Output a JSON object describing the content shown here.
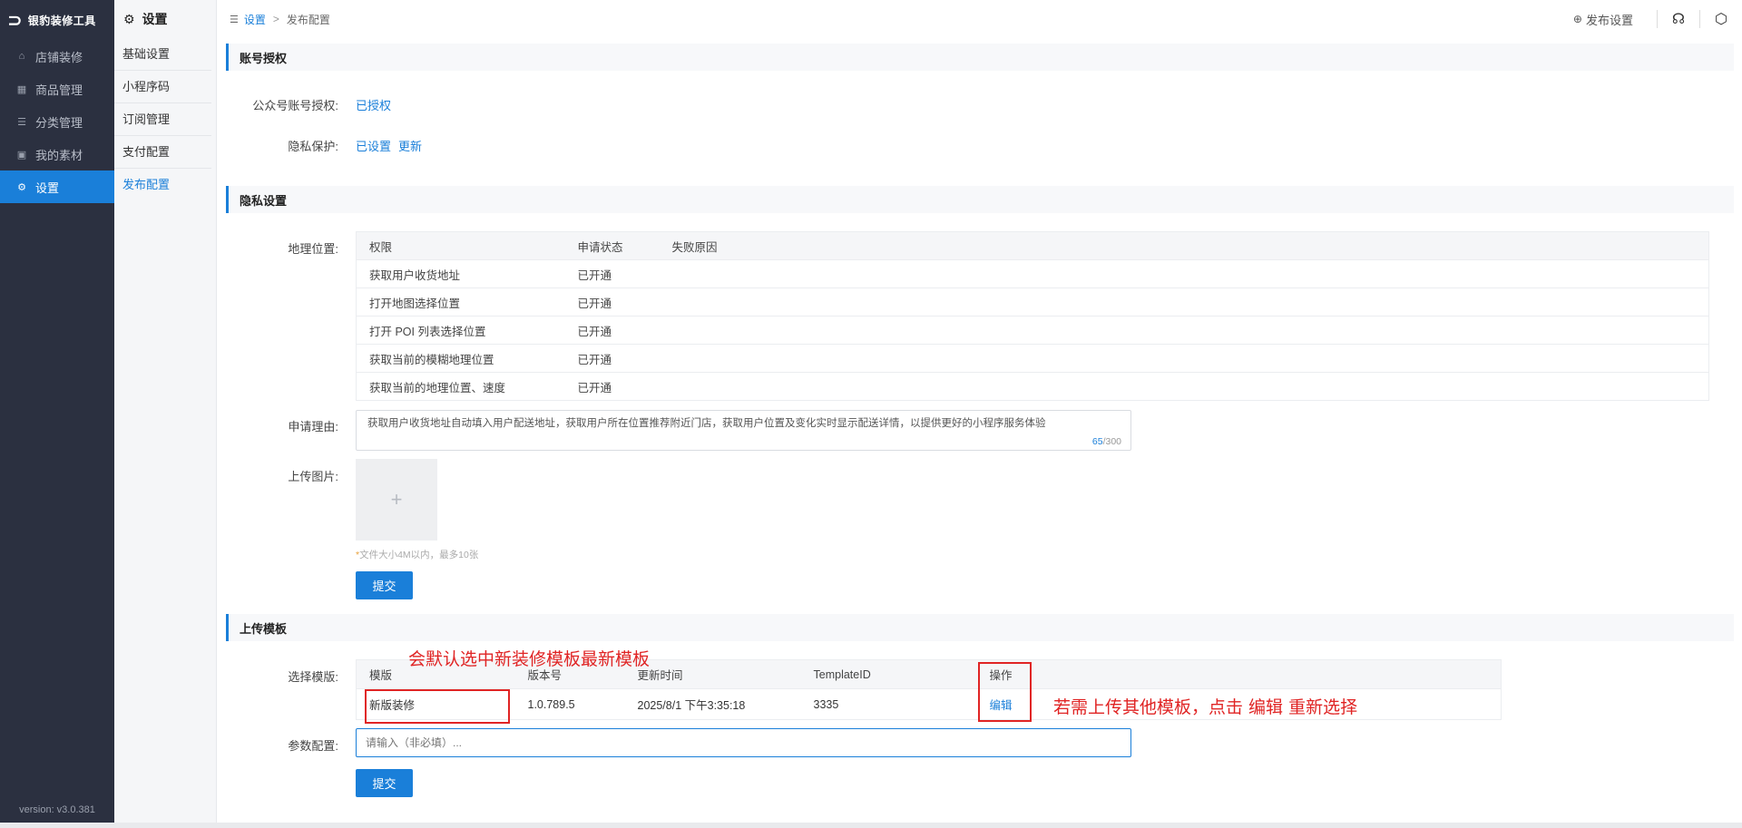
{
  "nav": {
    "brand": "银豹装修工具",
    "items": [
      {
        "label": "店铺装修",
        "icon": "store-icon"
      },
      {
        "label": "商品管理",
        "icon": "grid-icon"
      },
      {
        "label": "分类管理",
        "icon": "list-icon"
      },
      {
        "label": "我的素材",
        "icon": "image-icon"
      },
      {
        "label": "设置",
        "icon": "gear-icon",
        "active": true
      }
    ],
    "version": "version: v3.0.381"
  },
  "submenu": {
    "title": "设置",
    "items": [
      "基础设置",
      "小程序码",
      "订阅管理",
      "支付配置",
      "发布配置"
    ],
    "active_index": 4
  },
  "header": {
    "breadcrumb": [
      "设置",
      "发布配置"
    ],
    "publish_settings": "发布设置"
  },
  "account": {
    "section_title": "账号授权",
    "mp_label": "公众号账号授权:",
    "mp_value": "已授权",
    "privacy_label": "隐私保护:",
    "privacy_value": "已设置",
    "privacy_update": "更新"
  },
  "privacy": {
    "section_title": "隐私设置",
    "location_label": "地理位置:",
    "columns": [
      "权限",
      "申请状态",
      "失败原因"
    ],
    "rows": [
      [
        "获取用户收货地址",
        "已开通",
        ""
      ],
      [
        "打开地图选择位置",
        "已开通",
        ""
      ],
      [
        "打开 POI 列表选择位置",
        "已开通",
        ""
      ],
      [
        "获取当前的模糊地理位置",
        "已开通",
        ""
      ],
      [
        "获取当前的地理位置、速度",
        "已开通",
        ""
      ]
    ],
    "reason_label": "申请理由:",
    "reason_text": "获取用户收货地址自动填入用户配送地址，获取用户所在位置推荐附近门店，获取用户位置及变化实时显示配送详情，以提供更好的小程序服务体验",
    "reason_count": "65",
    "reason_max": "/300",
    "upload_label": "上传图片:",
    "upload_tip": "文件大小4M以内，最多10张",
    "submit": "提交"
  },
  "template": {
    "section_title": "上传模板",
    "select_label": "选择模版:",
    "columns": [
      "模版",
      "版本号",
      "更新时间",
      "TemplateID",
      "操作"
    ],
    "row": {
      "name": "新版装修",
      "version": "1.0.789.5",
      "updated": "2025/8/1 下午3:35:18",
      "template_id": "3335",
      "action": "编辑"
    },
    "param_label": "参数配置:",
    "param_placeholder": "请输入（非必填）...",
    "submit": "提交"
  },
  "annotations": {
    "note1": "会默认选中新装修模板最新模板",
    "note2": "若需上传其他模板，点击 编辑 重新选择",
    "color": "#e02424"
  },
  "colors": {
    "accent": "#1a7fd9",
    "nav_bg": "#2b3040"
  }
}
